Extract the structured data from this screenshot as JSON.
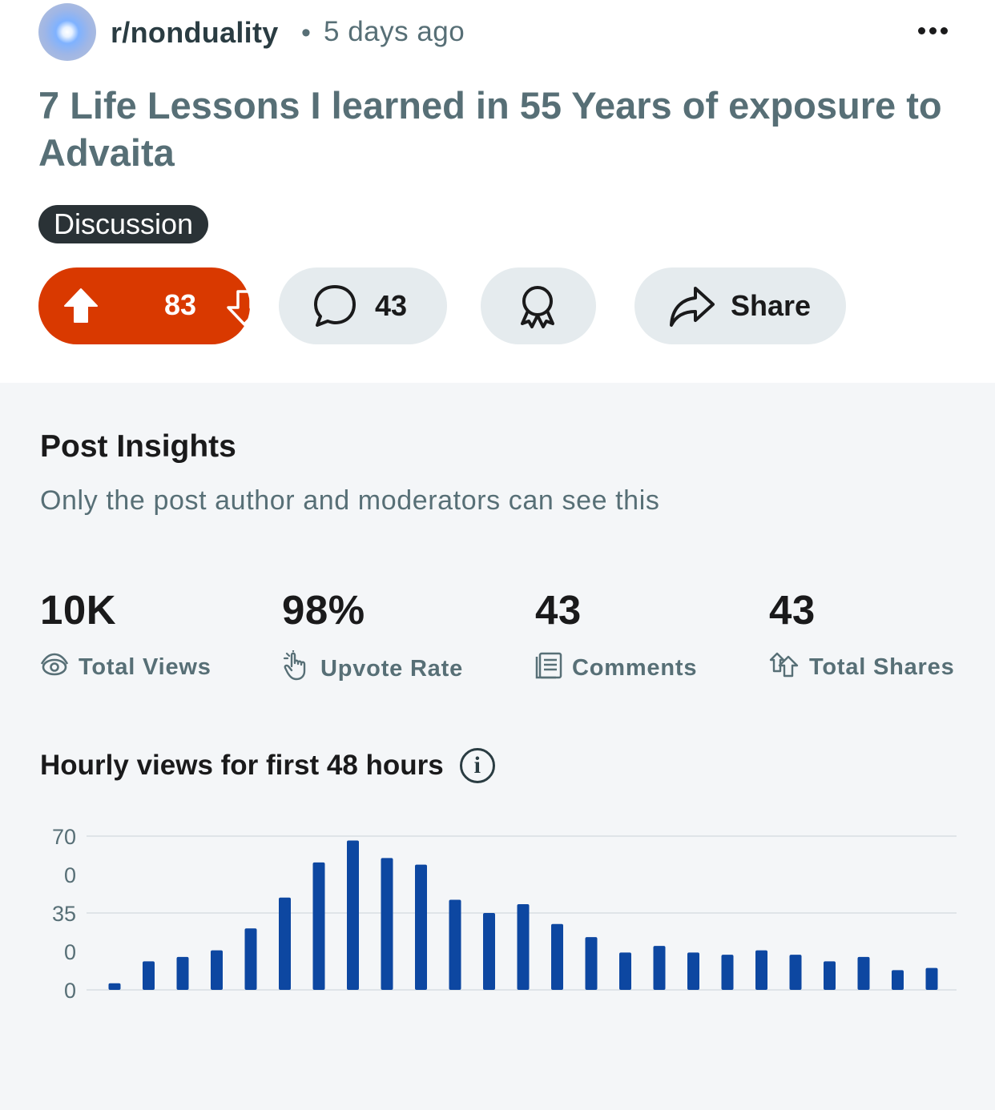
{
  "post": {
    "subreddit": "r/nonduality",
    "separator": "•",
    "time": "5 days ago",
    "title": "7 Life Lessons I learned in 55 Years of exposure to Advaita",
    "flair": "Discussion",
    "votes": "83",
    "comments": "43",
    "share_label": "Share",
    "vote_color": "#d93900"
  },
  "insights": {
    "title": "Post Insights",
    "subtitle": "Only the post author and moderators can see this",
    "stats": [
      {
        "value": "10K",
        "label": "Total Views",
        "icon": "eye-icon"
      },
      {
        "value": "98%",
        "label": "Upvote Rate",
        "icon": "hand-pointer-icon"
      },
      {
        "value": "43",
        "label": "Comments",
        "icon": "comments-doc-icon"
      },
      {
        "value": "43",
        "label": "Total Shares",
        "icon": "share-up-icon"
      }
    ],
    "chart_title": "Hourly views for first 48 hours"
  },
  "chart_data": {
    "type": "bar",
    "title": "Hourly views for first 48 hours",
    "y_tick_labels": [
      "70",
      "0",
      "35",
      "0",
      "0"
    ],
    "ylim": [
      0,
      70
    ],
    "grid": true,
    "bar_color": "#0d47a1",
    "values": [
      3,
      13,
      15,
      18,
      28,
      42,
      58,
      68,
      60,
      57,
      41,
      35,
      39,
      30,
      24,
      17,
      20,
      17,
      16,
      18,
      16,
      13,
      15,
      9,
      10
    ]
  }
}
